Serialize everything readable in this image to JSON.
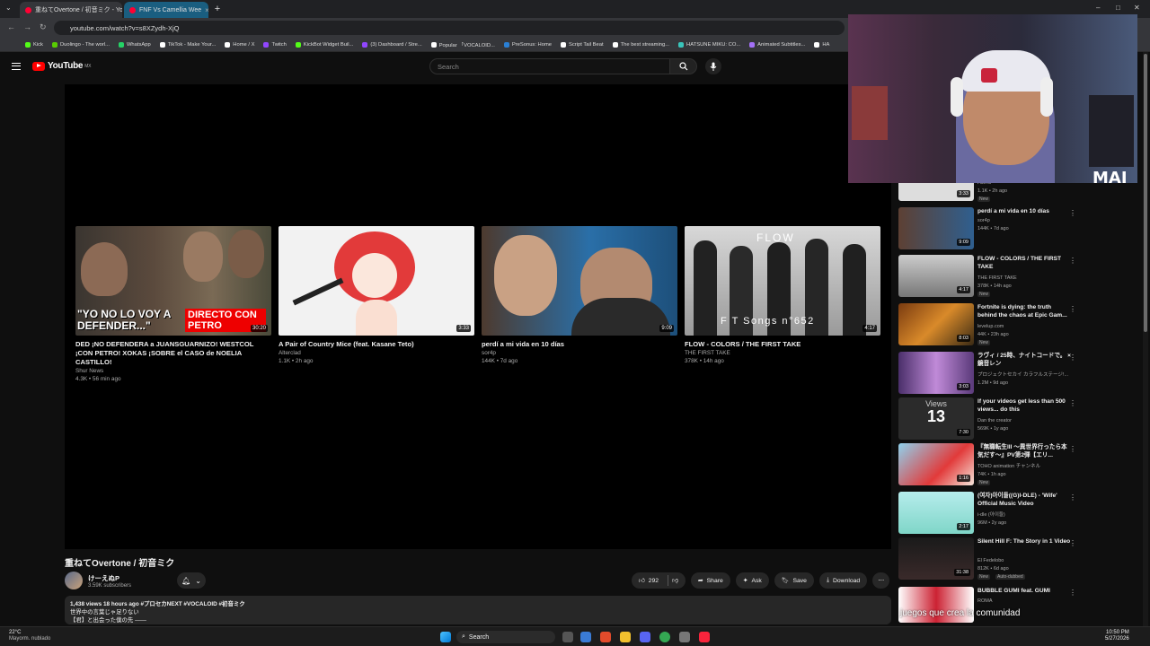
{
  "browser": {
    "tabs": [
      {
        "title": "重ねてOvertone / 初音ミク - You",
        "active": true
      },
      {
        "title": "FNF Vs Camellia Wee",
        "active": false
      }
    ],
    "url": "youtube.com/watch?v=s8XZydh-XjQ",
    "bookmarks": [
      "Kick",
      "Duolingo - The worl...",
      "WhatsApp",
      "TikTok - Make Your...",
      "Home / X",
      "Twitch",
      "KickBot Widget Buil...",
      "(3) Dashboard / Stre...",
      "Popular 「VOCALOID...",
      "PreSonus: Home",
      "Script Tail Beat",
      "The best streaming...",
      "HATSUNE MIKU: CO...",
      "Animated Subtitles...",
      "HA"
    ]
  },
  "youtube": {
    "logo_text": "YouTube",
    "region": "MX",
    "search_placeholder": "Search"
  },
  "endscreen": [
    {
      "title": "DED ¡NO DEFENDERA a JUANSGUARNIZO! WESTCOL ¡CON PETRO! XOKAS ¡SOBRE el CASO de NOELIA CASTILLO!",
      "channel": "Shur News",
      "meta": "4.3K • 56 min ago",
      "duration": "30:20",
      "overlay1": "\"YO NO LO VOY A DEFENDER...\"",
      "overlay2": "DIRECTO CON PETRO"
    },
    {
      "title": "A Pair of Country Mice (feat. Kasane Teto)",
      "channel": "Alterclad",
      "meta": "1.1K • 2h ago",
      "duration": "3:33"
    },
    {
      "title": "perdí a mi vida en 10 días",
      "channel": "sor4p",
      "meta": "144K • 7d ago",
      "duration": "9:09"
    },
    {
      "title": "FLOW - COLORS / THE FIRST TAKE",
      "channel": "THE FIRST TAKE",
      "meta": "378K • 14h ago",
      "duration": "4:17",
      "overlay1": "FLOW",
      "overlay2": "F T Songs n°652"
    }
  ],
  "video": {
    "title": "重ねてOvertone / 初音ミク",
    "channel": "けーえぬP",
    "subscribers": "3.59K subscribers",
    "likes": "292",
    "share": "Share",
    "ask": "Ask",
    "save": "Save",
    "download": "Download",
    "desc_line1": "1,438 views  18 hours ago  #プロセカNEXT #VOCALOID #初音ミク",
    "desc_line2": "世界中の言葉じゃ足りない",
    "desc_line3": "【君】と出会った僕の先 ——"
  },
  "recommendations": [
    {
      "title": "",
      "channel": "Altercl",
      "meta": "1.1K • 2h ago",
      "badge": "New",
      "duration": "3:33"
    },
    {
      "title": "perdí a mi vida en 10 días",
      "channel": "sor4p",
      "meta": "144K • 7d ago",
      "badge": "",
      "duration": "9:09"
    },
    {
      "title": "FLOW - COLORS / THE FIRST TAKE",
      "channel": "THE FIRST TAKE",
      "meta": "378K • 14h ago",
      "badge": "New",
      "duration": "4:17"
    },
    {
      "title": "Fortnite is dying: the truth behind the chaos at Epic Gam...",
      "channel": "levelup.com",
      "meta": "44K • 23h ago",
      "badge": "New",
      "duration": "8:03"
    },
    {
      "title": "ラヴィ / 25時、ナイトコードで。 × 鏡音レン",
      "channel": "プロジェクトセカイ カラフルステージ!...",
      "meta": "1.2M • 9d ago",
      "badge": "",
      "duration": "3:03"
    },
    {
      "title": "If your videos get less than 500 views... do this",
      "channel": "Dan the creator",
      "meta": "569K • 1y ago",
      "badge": "",
      "duration": "7:30",
      "thumb_top": "Views",
      "thumb_num": "13"
    },
    {
      "title": "『無職転生III ～異世界行ったら本気だす～』PV第2弾【エリ...",
      "channel": "TOHO animation チャンネル",
      "meta": "74K • 1h ago",
      "badge": "New",
      "duration": "1:16"
    },
    {
      "title": "(여자)아이들((G)I-DLE) - 'Wife' Official Music Video",
      "channel": "i-dle (아이들)",
      "meta": "96M • 2y ago",
      "badge": "",
      "duration": "2:17"
    },
    {
      "title": "Silent Hill F: The Story in 1 Video",
      "channel": "El Fedelobo",
      "meta": "812K • 6d ago",
      "badge": "New",
      "badge2": "Auto-dubbed",
      "duration": "31:38"
    },
    {
      "title": "BUBBLE GUMI feat. GUMI",
      "channel": "ROMA",
      "meta": "",
      "badge": "",
      "duration": ""
    }
  ],
  "stream": {
    "watermark": "MAI",
    "caption": "juegos que crea la comunidad"
  },
  "taskbar": {
    "weather_temp": "22°C",
    "weather_desc": "Mayorm. nublado",
    "search": "Search",
    "time": "10:50 PM",
    "date": "5/27/2026"
  }
}
